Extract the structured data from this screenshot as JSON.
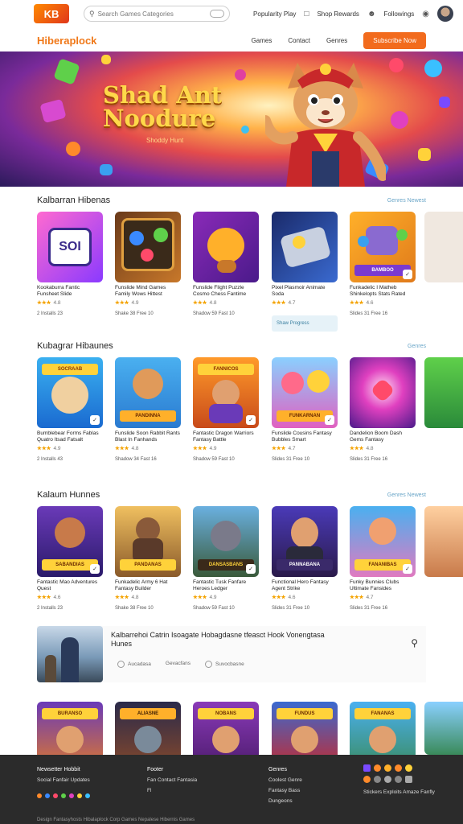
{
  "topbar": {
    "logo_text": "KB",
    "search_placeholder": "Search Games Categories",
    "link_1": "Popularity Play",
    "link_2": "Shop Rewards",
    "link_3": "Followings"
  },
  "navbar": {
    "brand": "Hiberaplock",
    "links": [
      "Games",
      "Contact",
      "Genres"
    ],
    "cta": "Subscribe Now"
  },
  "hero": {
    "title": "Shad Ant Noodure",
    "subtitle": "Shoddy Hunt"
  },
  "sections": [
    {
      "title": "Kalbarran Hibenas",
      "link": "Genres Newest",
      "cards": [
        {
          "tag": "SOI",
          "title": "Kookaburra Fantic Funsheet Slide",
          "stars": "★★★",
          "rating": "4.8",
          "meta": "2 Installs 23"
        },
        {
          "tag": "",
          "title": "Funslide Mind Games Family Wows Hittest",
          "stars": "★★★",
          "rating": "4.9",
          "meta": "Shake 38 Free 10"
        },
        {
          "tag": "",
          "title": "Funslide Flight Puzzle Cosmo Chess Fantime",
          "stars": "★★★",
          "rating": "4.8",
          "meta": "Shadow 59 Fast 10"
        },
        {
          "tag": "",
          "title": "Pixel Plasmoir Animate Soda",
          "stars": "★★★",
          "rating": "4.7",
          "meta": ""
        },
        {
          "tag": "BAMBOO",
          "title": "Funkadelic I Matheb Shinkelopts Stats Rated",
          "stars": "★★★",
          "rating": "4.6",
          "meta": "Slides 31 Free 16"
        }
      ],
      "hint": "Shaw Progress"
    },
    {
      "title": "Kubagrar Hibaunes",
      "link": "Genres",
      "cards": [
        {
          "tag": "SOCRAAB",
          "title": "Bumblebear Forms Fablas Quatro Itsad Fatsalt",
          "stars": "★★★",
          "rating": "4.9",
          "meta": "2 Installs 43"
        },
        {
          "tag": "PANDINNA",
          "title": "Funslide Soon Rabbit Rants Blast In Fanhands",
          "stars": "★★★",
          "rating": "4.8",
          "meta": "Shadow 34 Fast 16"
        },
        {
          "tag": "FANNICOS",
          "title": "Fantastic Dragon Warriors Fantasy Battle",
          "stars": "★★★",
          "rating": "4.9",
          "meta": "Shadow 59 Fast 10"
        },
        {
          "tag": "FUNKARNAN",
          "title": "Funslide Cousins Fantasy Bubbles Smart",
          "stars": "★★★",
          "rating": "4.7",
          "meta": "Slides 31 Free 10"
        },
        {
          "tag": "",
          "title": "Dandelion Boom Dash Gems Fantasy",
          "stars": "★★★",
          "rating": "4.8",
          "meta": "Slides 31 Free 16"
        }
      ]
    },
    {
      "title": "Kalaum Hunnes",
      "link": "Genres Newest",
      "cards": [
        {
          "tag": "SABANDIAS",
          "title": "Fantastic Mao Adventures Quest",
          "stars": "★★★",
          "rating": "4.6",
          "meta": "2 Installs 23"
        },
        {
          "tag": "PANDANAS",
          "title": "Funkadelic Army 6 Hat Fantasy Builder",
          "stars": "★★★",
          "rating": "4.8",
          "meta": "Shake 38 Free 10"
        },
        {
          "tag": "DANSASBANS",
          "title": "Fantastic Tusk Fanfare Heroes Ledger",
          "stars": "★★★",
          "rating": "4.9",
          "meta": "Shadow 59 Fast 10"
        },
        {
          "tag": "PANNABANA",
          "title": "Functional Hero Fantasy Agent Strike",
          "stars": "★★★",
          "rating": "4.6",
          "meta": "Slides 31 Free 10"
        },
        {
          "tag": "FANANIBAS",
          "title": "Funky Bunnies Clubs Ultimate Fansides",
          "stars": "★★★",
          "rating": "4.7",
          "meta": "Slides 31 Free 16"
        }
      ]
    }
  ],
  "feature": {
    "title": "Kalbarrehoi Catrin Isoagate Hobagdasne tfeasct Hook Vonengtasa Hunes",
    "chips": [
      "Aucadasa",
      "Gevacfans",
      "Suvocbasne"
    ]
  },
  "bottom_row": {
    "tags": [
      "BURANSO",
      "ALIASNE",
      "NOBANS",
      "FUNDUS",
      "FANANAS"
    ]
  },
  "footer": {
    "col1_head": "Newsetter Hobbit",
    "col1_sub": "Social Fanfair Updates",
    "col2_head": "Footer",
    "col2_items": [
      "Fan Contact Fantasia",
      "Fl"
    ],
    "col3_head": "Genres",
    "col3_items": [
      "Coolest Genre",
      "Fantasy Bass",
      "Dungeons"
    ],
    "col4_items": [
      "Stickers Exploits Amaze Fanfly"
    ],
    "copyright": "Design Fantasyhosts Hibalaplock Corp Games Nepalese Hibernis Games"
  }
}
